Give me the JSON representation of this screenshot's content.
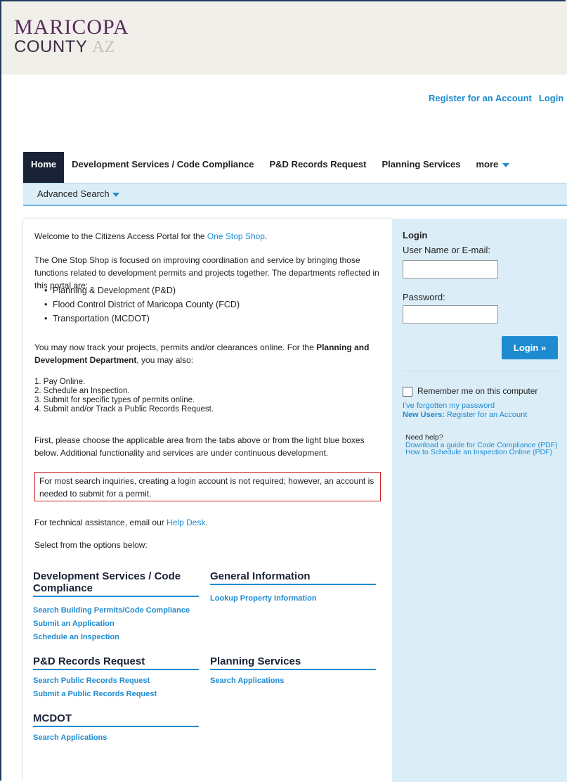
{
  "brand": {
    "line1": "MARICOPA",
    "line2a": "COUNTY",
    "line2b": "AZ"
  },
  "top_links": {
    "register": "Register for an Account",
    "login": "Login"
  },
  "tabs": [
    {
      "label": "Home"
    },
    {
      "label": "Development Services / Code Compliance"
    },
    {
      "label": "P&D Records Request"
    },
    {
      "label": "Planning Services"
    },
    {
      "label": "more"
    }
  ],
  "subnav": {
    "advanced_search": "Advanced Search"
  },
  "welcome": {
    "prefix": "Welcome to the Citizens Access Portal for the ",
    "link": "One Stop Shop",
    "suffix": "."
  },
  "intro": "The One Stop Shop is focused on improving coordination and service by bringing those functions related to development permits and projects together. The departments reflected in this portal are:",
  "departments": [
    "Planning & Development (P&D)",
    "Flood Control District of Maricopa County (FCD)",
    "Transportation (MCDOT)"
  ],
  "track": {
    "prefix": "You may now track your projects, permits and/or clearances online. For the ",
    "bold": "Planning and Development Department",
    "suffix": ", you may also:"
  },
  "steps": [
    "1. Pay Online.",
    "2. Schedule an Inspection.",
    "3. Submit for specific types of permits online.",
    "4. Submit and/or Track a Public Records Request."
  ],
  "first": "First, please choose the applicable area from the tabs above or from the light blue boxes below. Additional functionality and services are under continuous development.",
  "notice": "For most search inquiries, creating a login account is not required; however, an account is needed to submit for a permit.",
  "tech": {
    "prefix": "For technical assistance, email our ",
    "link": "Help Desk",
    "suffix": "."
  },
  "select": "Select from the options below:",
  "sections": {
    "dev": {
      "title": "Development Services / Code Compliance",
      "links": [
        "Search Building Permits/Code Compliance",
        "Submit an Application",
        "Schedule an Inspection"
      ]
    },
    "general": {
      "title": "General Information",
      "links": [
        "Lookup Property Information"
      ]
    },
    "records": {
      "title": "P&D Records Request",
      "links": [
        "Search Public Records Request",
        "Submit a Public Records Request"
      ]
    },
    "planning": {
      "title": "Planning Services",
      "links": [
        "Search Applications"
      ]
    },
    "mcdot": {
      "title": "MCDOT",
      "links": [
        "Search Applications"
      ]
    }
  },
  "login": {
    "title": "Login",
    "user_label": "User Name or E-mail:",
    "password_label": "Password:",
    "button": "Login »",
    "remember": "Remember me on this computer",
    "forgot": "I've forgotten my password",
    "new_users_bold": "New Users:",
    "new_users_link": " Register for an Account",
    "need_help": "Need help?",
    "help_links": [
      "Download a guide for Code Compliance (PDF)",
      "How to Schedule an Inspection Online (PDF)"
    ]
  }
}
